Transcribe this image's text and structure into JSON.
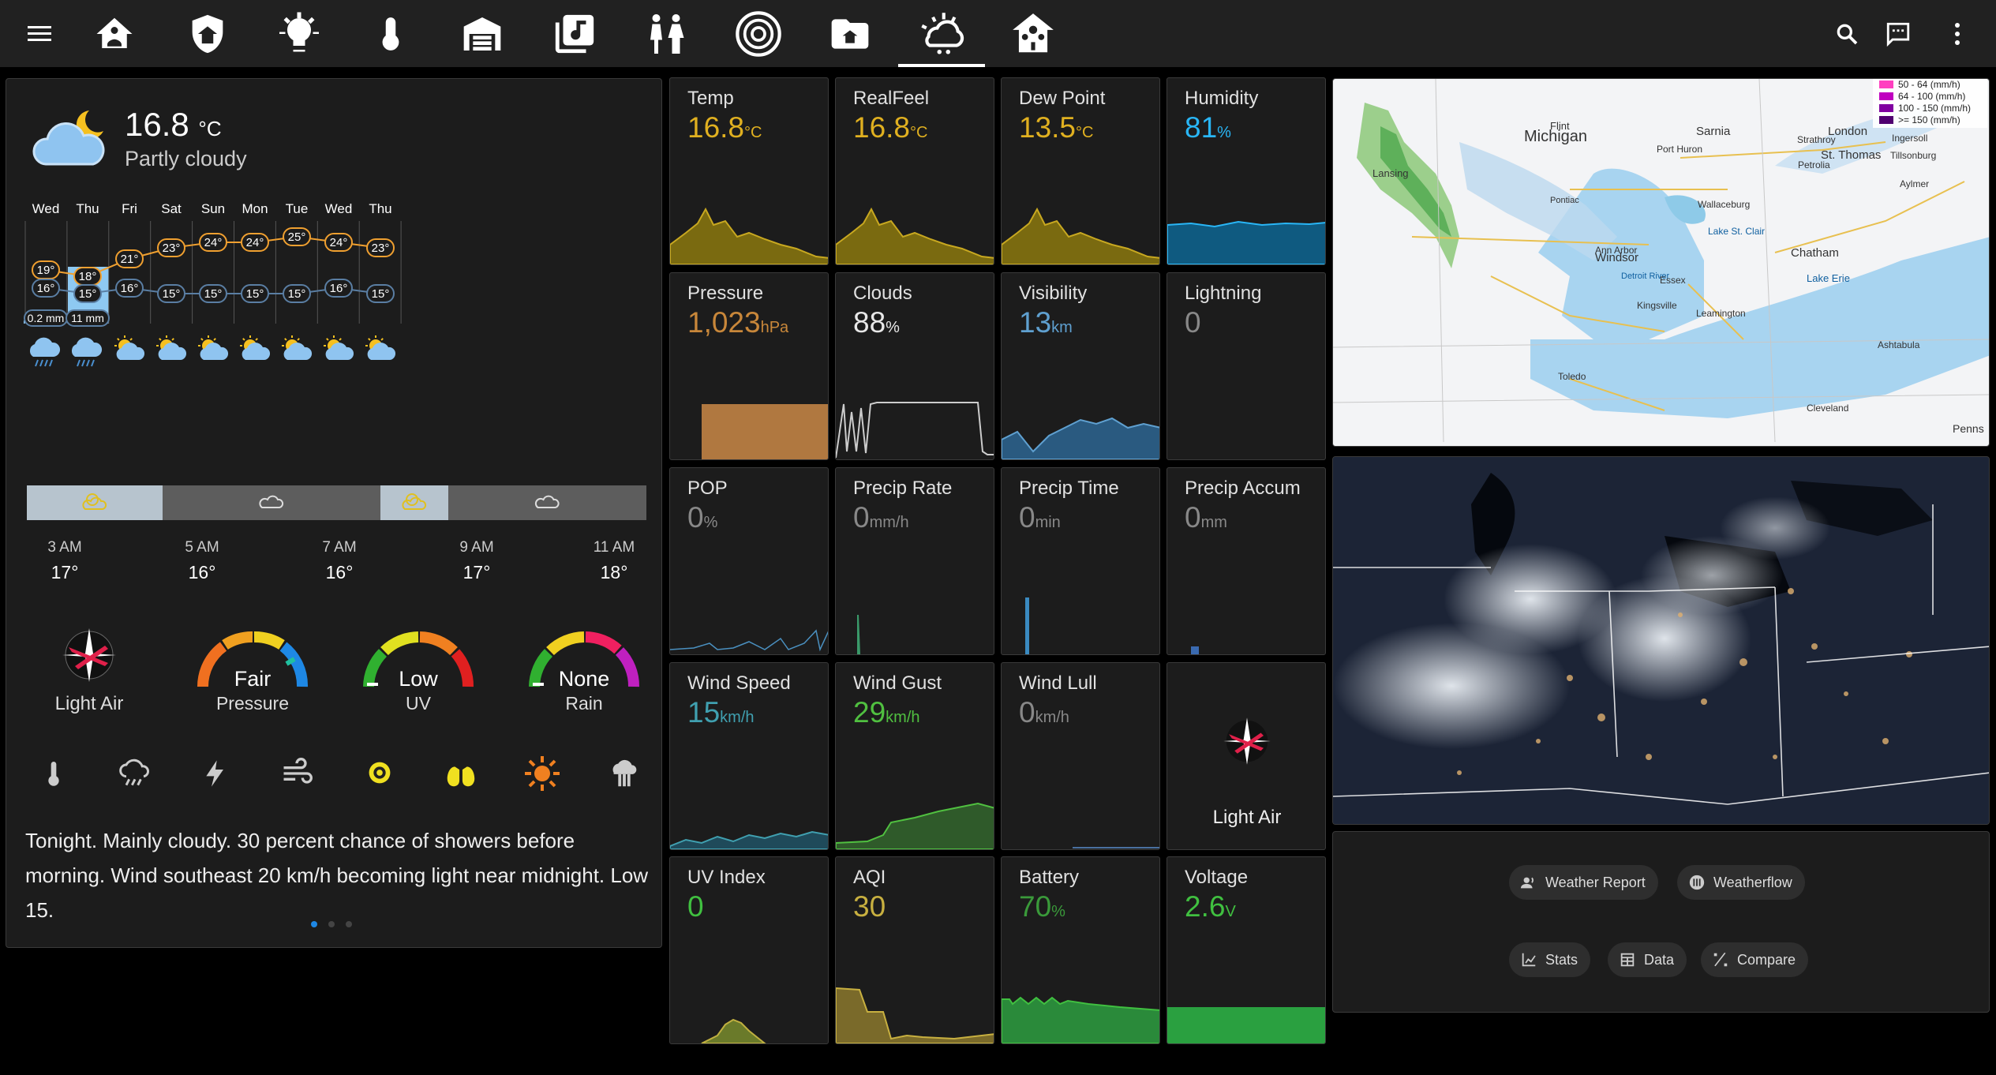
{
  "nav": {
    "icons": [
      "menu-icon",
      "home-icon",
      "shield-home-icon",
      "lightbulb-icon",
      "thermometer-icon",
      "garage-icon",
      "media-icon",
      "people-icon",
      "speaker-icon",
      "folder-home-icon",
      "weather-icon",
      "home-automation-icon",
      "search-icon",
      "chat-icon",
      "more-vertical-icon"
    ],
    "active": "weather-icon"
  },
  "current": {
    "temp": "16.8",
    "unit": "°C",
    "condition": "Partly cloudy"
  },
  "daily": {
    "days": [
      "Wed",
      "Thu",
      "Fri",
      "Sat",
      "Sun",
      "Mon",
      "Tue",
      "Wed",
      "Thu"
    ],
    "highs": [
      "19°",
      "18°",
      "21°",
      "23°",
      "24°",
      "24°",
      "25°",
      "24°",
      "23°"
    ],
    "lows": [
      "16°",
      "15°",
      "16°",
      "15°",
      "15°",
      "15°",
      "15°",
      "16°",
      "15°"
    ],
    "precip": [
      "0.2 mm",
      "11 mm"
    ],
    "icons": [
      "rain-icon",
      "rain-icon",
      "partly-sunny-icon",
      "partly-sunny-icon",
      "partly-sunny-icon",
      "partly-sunny-icon",
      "partly-sunny-icon",
      "partly-sunny-icon",
      "partly-sunny-icon"
    ]
  },
  "hourly": {
    "times": [
      "3 AM",
      "5 AM",
      "7 AM",
      "9 AM",
      "11 AM"
    ],
    "temps": [
      "17°",
      "16°",
      "16°",
      "17°",
      "18°"
    ]
  },
  "gauges": {
    "wind": "Light Air",
    "pressure_value": "Fair",
    "pressure_label": "Pressure",
    "uv_value": "Low",
    "uv_label": "UV",
    "rain_value": "None",
    "rain_label": "Rain"
  },
  "forecast_text": "Tonight. Mainly cloudy. 30 percent chance of showers before morning. Wind southeast 20 km/h becoming light near midnight. Low 15.",
  "tiles": [
    {
      "label": "Temp",
      "value": "16.8",
      "unit": "°C",
      "color": "#e0b020"
    },
    {
      "label": "RealFeel",
      "value": "16.8",
      "unit": "°C",
      "color": "#e0b020"
    },
    {
      "label": "Dew Point",
      "value": "13.5",
      "unit": "°C",
      "color": "#e0b020"
    },
    {
      "label": "Humidity",
      "value": "81",
      "unit": "%",
      "color": "#29b6f6"
    },
    {
      "label": "Pressure",
      "value": "1,023",
      "unit": "hPa",
      "color": "#c8873a"
    },
    {
      "label": "Clouds",
      "value": "88",
      "unit": "%",
      "color": "#e8e8e8"
    },
    {
      "label": "Visibility",
      "value": "13",
      "unit": "km",
      "color": "#5fa0d0"
    },
    {
      "label": "Lightning",
      "value": "0",
      "unit": "",
      "color": "#888888"
    },
    {
      "label": "POP",
      "value": "0",
      "unit": "%",
      "color": "#888888"
    },
    {
      "label": "Precip Rate",
      "value": "0",
      "unit": "mm/h",
      "color": "#888888"
    },
    {
      "label": "Precip Time",
      "value": "0",
      "unit": "min",
      "color": "#888888"
    },
    {
      "label": "Precip Accum",
      "value": "0",
      "unit": "mm",
      "color": "#888888"
    },
    {
      "label": "Wind Speed",
      "value": "15",
      "unit": "km/h",
      "color": "#40a0b0"
    },
    {
      "label": "Wind Gust",
      "value": "29",
      "unit": "km/h",
      "color": "#50c040"
    },
    {
      "label": "Wind Lull",
      "value": "0",
      "unit": "km/h",
      "color": "#888888"
    },
    {
      "label": "",
      "value": "",
      "unit": "",
      "color": "#ffffff"
    },
    {
      "label": "UV Index",
      "value": "0",
      "unit": "",
      "color": "#40c040"
    },
    {
      "label": "AQI",
      "value": "30",
      "unit": "",
      "color": "#c8b040"
    },
    {
      "label": "Battery",
      "value": "70",
      "unit": "%",
      "color": "#3a9a3a"
    },
    {
      "label": "Voltage",
      "value": "2.6",
      "unit": "V",
      "color": "#40c040"
    }
  ],
  "wind_tile_label": "Light Air",
  "map": {
    "places": [
      "Michigan",
      "Flint",
      "Sarnia",
      "Strathroy",
      "London",
      "Ingersoll",
      "St. Thomas",
      "Tillsonburg",
      "Aylmer",
      "Petrolia",
      "Port Huron",
      "Lansing",
      "Pontiac",
      "Wallaceburg",
      "Lake St. Clair",
      "Chatham",
      "Ann Arbor",
      "Windsor",
      "Detroit River",
      "Essex",
      "Kingsville",
      "Leamington",
      "Lake Erie",
      "Toledo",
      "Ashtabula",
      "Cleveland",
      "Penns"
    ],
    "legend": [
      "50 - 64 (mm/h)",
      "64 - 100 (mm/h)",
      "100 - 150 (mm/h)",
      ">= 150 (mm/h)"
    ],
    "legend_colors": [
      "#ff40c0",
      "#c000c0",
      "#8000a0",
      "#500070"
    ]
  },
  "buttons": {
    "row1": [
      "Weather Report",
      "Weatherflow"
    ],
    "row2": [
      "Stats",
      "Data",
      "Compare"
    ]
  }
}
